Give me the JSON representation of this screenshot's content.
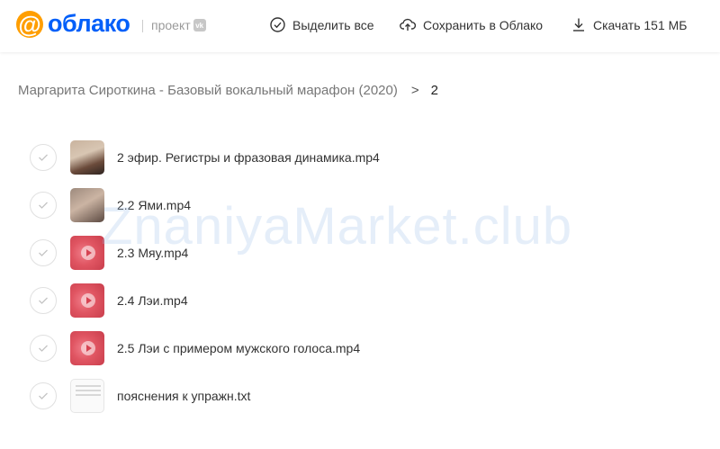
{
  "header": {
    "logo_symbol": "@",
    "logo_text": "облако",
    "project_label": "проект",
    "vk_badge": "vk",
    "select_all": "Выделить все",
    "save_to_cloud": "Сохранить в Облако",
    "download": "Скачать 151 МБ"
  },
  "breadcrumb": {
    "parent": "Маргарита Сироткина - Базовый вокальный марафон (2020)",
    "separator": ">",
    "current": "2"
  },
  "files": [
    {
      "name": "2 эфир. Регистры и фразовая динамика.mp4",
      "thumb": "video1"
    },
    {
      "name": "2.2 Ями.mp4",
      "thumb": "video2"
    },
    {
      "name": "2.3 Мяу.mp4",
      "thumb": "video-red"
    },
    {
      "name": "2.4 Лэи.mp4",
      "thumb": "video-red"
    },
    {
      "name": "2.5 Лэи с примером мужского голоса.mp4",
      "thumb": "video-red"
    },
    {
      "name": "пояснения к упражн.txt",
      "thumb": "text"
    }
  ],
  "watermark": "ZnaniyaMarket.club",
  "colors": {
    "brand_blue": "#005ff9",
    "brand_orange": "#ff9e00"
  }
}
